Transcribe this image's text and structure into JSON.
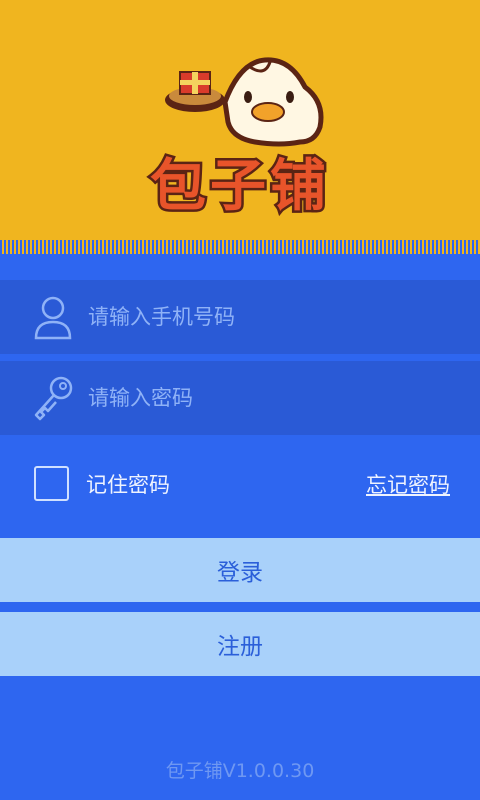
{
  "app": {
    "logo_text": "包子铺",
    "version": "包子铺V1.0.0.30"
  },
  "login_form": {
    "phone_placeholder": "请输入手机号码",
    "password_placeholder": "请输入密码",
    "remember_label": "记住密码",
    "remember_checked": false,
    "forgot_label": "忘记密码",
    "login_label": "登录",
    "register_label": "注册"
  },
  "icons": {
    "phone_field": "user-icon",
    "password_field": "key-icon"
  },
  "colors": {
    "header_bg": "#f0b51f",
    "body_bg": "#2e66f0",
    "field_bg": "#2a5ad6",
    "button_bg": "#a9d1fa",
    "button_text": "#2b5fd9"
  }
}
